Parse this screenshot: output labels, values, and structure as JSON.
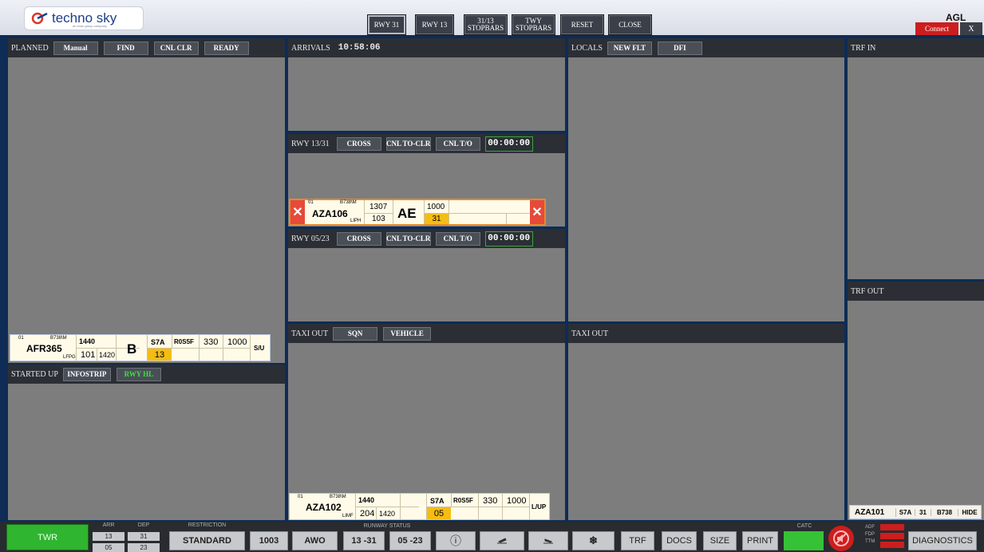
{
  "app": {
    "logo_text": "techno sky",
    "logo_sub": "an enav group company",
    "station": "AGL",
    "connect_label": "Connect",
    "close_x": "X"
  },
  "toolbar": [
    {
      "label": "RWY 31",
      "selected": true
    },
    {
      "label": "RWY 13",
      "selected": false
    },
    {
      "label": "31/13 STOPBARS",
      "selected": false
    },
    {
      "label": "TWY STOPBARS",
      "selected": false
    },
    {
      "label": "RESET",
      "selected": false
    },
    {
      "label": "CLOSE",
      "selected": false
    }
  ],
  "planned": {
    "title": "PLANNED",
    "manual": "Manual",
    "find": "FIND",
    "cnl_clr": "CNL CLR",
    "ready": "READY",
    "strip": {
      "seq": "01",
      "type": "B738\\M",
      "callsign": "AFR365",
      "origin": "LFPG",
      "time1": "1440",
      "v1": "101",
      "v2": "1420",
      "cat": "B",
      "sid": "S7A",
      "route": "R0S5F",
      "hdg": "330",
      "alt": "1000",
      "rwy": "13",
      "status": "S/U"
    }
  },
  "started_up": {
    "title": "STARTED UP",
    "infostrip": "INFOSTRIP",
    "rwy_hl": "RWY HL"
  },
  "arrivals": {
    "title": "ARRIVALS",
    "time": "10:58:06"
  },
  "rwy1331": {
    "title": "RWY 13/31",
    "cross": "CROSS",
    "cnl_to_clr": "CNL TO-CLR",
    "cnl_to": "CNL T/O",
    "timer": "00:00:00",
    "strip": {
      "seq": "01",
      "type": "B738\\M",
      "callsign": "AZA106",
      "dest": "LIPH",
      "v1": "1307",
      "v2": "103",
      "cat": "AE",
      "alt": "1000",
      "rwy": "31"
    }
  },
  "rwy0523": {
    "title": "RWY 05/23",
    "cross": "CROSS",
    "cnl_to_clr": "CNL TO-CLR",
    "cnl_to": "CNL T/O",
    "timer": "00:00:00"
  },
  "taxi_out_left": {
    "title": "TAXI OUT",
    "sqn": "SQN",
    "vehicle": "VEHICLE",
    "strip": {
      "seq": "01",
      "type": "B738\\M",
      "callsign": "AZA102",
      "dest": "LIMF",
      "time1": "1440",
      "v1": "204",
      "v2": "1420",
      "sid": "S7A",
      "route": "R0S5F",
      "hdg": "330",
      "alt": "1000",
      "rwy": "05",
      "status": "L/UP"
    }
  },
  "locals": {
    "title": "LOCALS",
    "new_flt": "NEW FLT",
    "dfi": "DFI"
  },
  "taxi_out_right": {
    "title": "TAXI OUT"
  },
  "trf_in": {
    "title": "TRF IN"
  },
  "trf_out": {
    "title": "TRF OUT",
    "row": {
      "callsign": "AZA101",
      "sid": "S7A",
      "rwy": "31",
      "type": "B738",
      "hide": "HIDE"
    }
  },
  "bottom": {
    "twr": "TWR",
    "arr_label": "ARR",
    "dep_label": "DEP",
    "arr1": "13",
    "dep1": "31",
    "arr2": "05",
    "dep2": "23",
    "restriction_label": "RESTRICTION",
    "restriction": "STANDARD",
    "qnh": "1003",
    "awo": "AWO",
    "runway_status_label": "RUNWAY STATUS",
    "rs1": "13 -31",
    "rs2": "05 -23",
    "info_icon": "ⓘ",
    "snow_icon": "❄",
    "trf": "TRF",
    "docs": "DOCS",
    "size": "SIZE",
    "print": "PRINT",
    "catc_label": "CATC",
    "adf": "ADF",
    "fdp": "FDP",
    "ttm": "TTM",
    "diagnostics": "DIAGNOSTICS"
  },
  "colors": {
    "bg": "#0e2c55",
    "panel": "#7d7d7d",
    "header": "#2b2f35",
    "strip": "#fffbe8",
    "amber": "#f5bc14",
    "green": "#2fb52f",
    "red": "#cc1e1e"
  }
}
